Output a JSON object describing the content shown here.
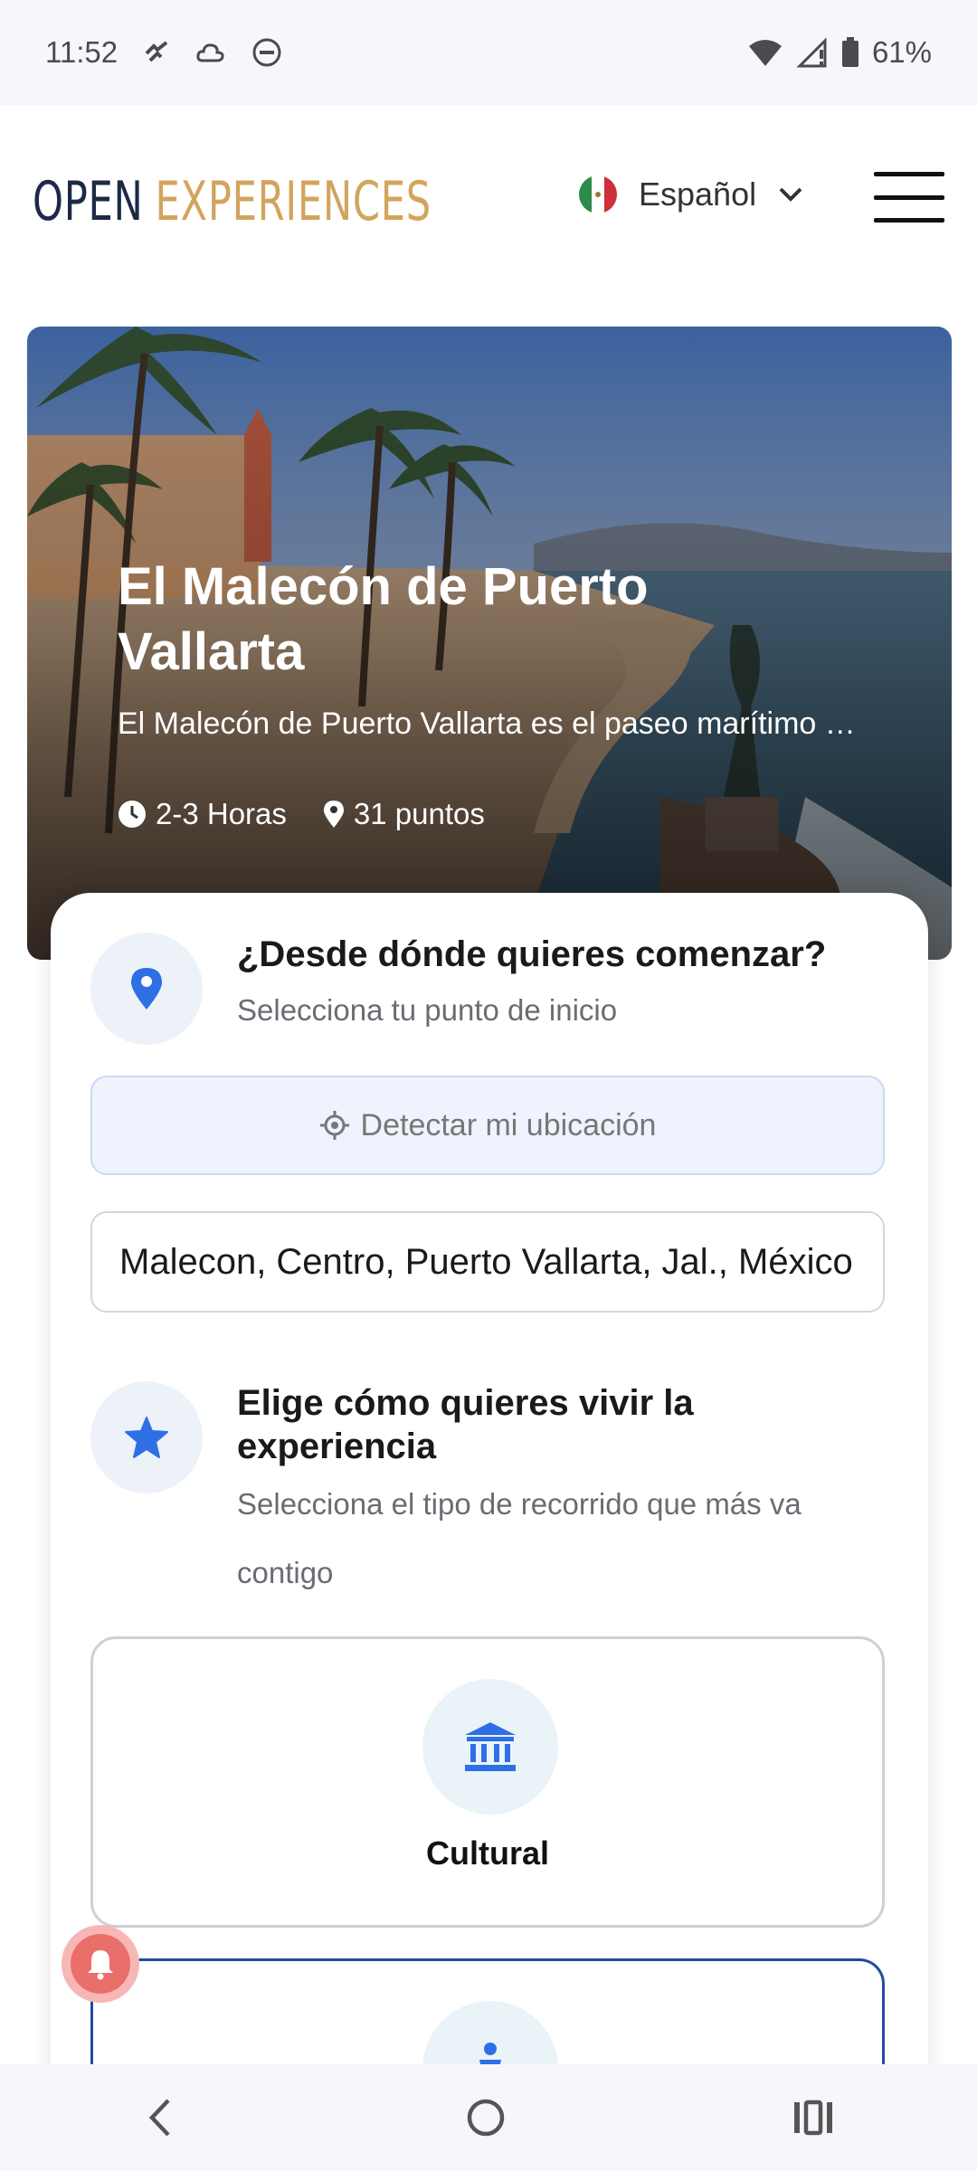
{
  "status": {
    "time": "11:52",
    "battery": "61%",
    "icons": [
      "missed-call-icon",
      "cloud-icon",
      "circle-badge-icon",
      "wifi-icon",
      "signal-icon",
      "battery-icon"
    ]
  },
  "header": {
    "logo_part1": "OPEN",
    "logo_part2": "EXPERIENCES",
    "language": "Español",
    "language_flag": "mexico-flag-icon",
    "menu_icon": "hamburger-menu-icon"
  },
  "hero": {
    "title": "El Malecón de Puerto Vallarta",
    "description": "El Malecón de Puerto Vallarta es el paseo marítimo más emblemático de la ciudad",
    "duration": "2-3 Horas",
    "points": "31 puntos"
  },
  "start_step": {
    "title": "¿Desde dónde quieres comenzar?",
    "subtitle": "Selecciona tu punto de inicio",
    "detect_label": "Detectar mi ubicación",
    "address_value": "Malecon, Centro, Puerto Vallarta, Jal., México"
  },
  "experience_step": {
    "title": "Elige cómo quieres vivir la experiencia",
    "subtitle": "Selecciona el tipo de recorrido que más va contigo",
    "options": [
      {
        "label": "Cultural",
        "icon": "museum-icon"
      },
      {
        "label": "",
        "icon": "person-icon"
      }
    ]
  },
  "colors": {
    "accent_blue": "#2f6fe6",
    "logo_navy": "#1b2a45",
    "logo_gold": "#d3a45e",
    "selected_border": "#1f4e9c"
  },
  "nav": {
    "icons": [
      "back-icon",
      "home-icon",
      "recents-icon"
    ]
  }
}
